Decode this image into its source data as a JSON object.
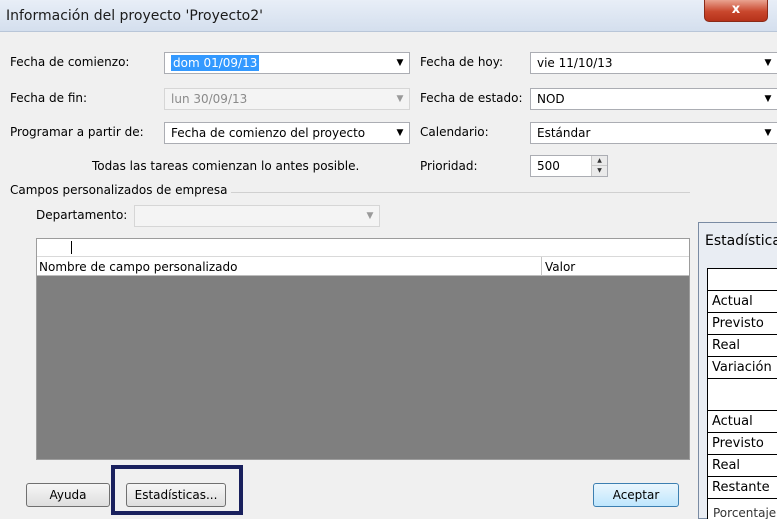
{
  "window": {
    "title": "Información del proyecto 'Proyecto2'",
    "close_glyph": "x"
  },
  "form": {
    "start_date": {
      "label": "Fecha de comienzo:",
      "value": "dom 01/09/13"
    },
    "finish_date": {
      "label": "Fecha de fin:",
      "value": "lun 30/09/13"
    },
    "schedule_from": {
      "label": "Programar a partir de:",
      "value": "Fecha de comienzo del proyecto"
    },
    "schedule_note": "Todas las tareas comienzan lo antes posible.",
    "today_date": {
      "label": "Fecha de hoy:",
      "value": "vie 11/10/13"
    },
    "status_date": {
      "label": "Fecha de estado:",
      "value": "NOD"
    },
    "calendar": {
      "label": "Calendario:",
      "value": "Estándar"
    },
    "priority": {
      "label": "Prioridad:",
      "value": "500"
    }
  },
  "custom_fields": {
    "group_label": "Campos personalizados de empresa",
    "department_label": "Departamento:",
    "department_value": "",
    "columns": [
      "Nombre de campo personalizado",
      "Valor"
    ]
  },
  "buttons": {
    "help": "Ayuda",
    "statistics": "Estadísticas...",
    "ok": "Aceptar"
  },
  "statistics_panel": {
    "title": "Estadísticas",
    "rows": [
      "",
      "Actual",
      "Previsto",
      "Real",
      "Variación",
      "",
      "Actual",
      "Previsto",
      "Real",
      "Restante"
    ],
    "footer": "Porcentaje"
  },
  "colors": {
    "highlight_box": "#19205d",
    "selection": "#3399ff",
    "grid_background": "#7f7f7f"
  }
}
